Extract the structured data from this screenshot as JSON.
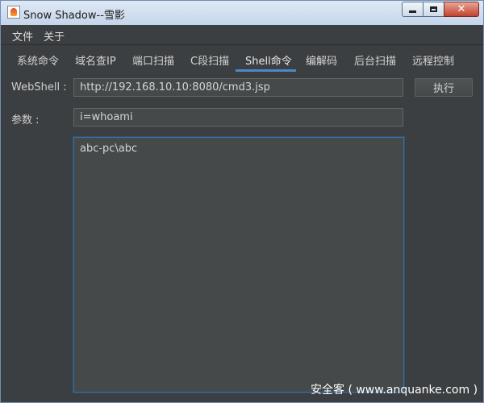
{
  "window": {
    "title": "Snow Shadow--雪影"
  },
  "menubar": {
    "items": [
      "文件",
      "关于"
    ]
  },
  "tabs": [
    {
      "label": "系统命令",
      "active": false
    },
    {
      "label": "域名查IP",
      "active": false
    },
    {
      "label": "端口扫描",
      "active": false
    },
    {
      "label": "C段扫描",
      "active": false
    },
    {
      "label": "Shell命令",
      "active": true
    },
    {
      "label": "编解码",
      "active": false
    },
    {
      "label": "后台扫描",
      "active": false
    },
    {
      "label": "远程控制",
      "active": false
    }
  ],
  "form": {
    "webshell_label": "WebShell :",
    "webshell_value": "http://192.168.10.10:8080/cmd3.jsp",
    "execute_label": "执行",
    "params_label": "参数 :",
    "params_value": "i=whoami",
    "output_text": "abc-pc\\abc"
  },
  "watermark": "安全客 ( www.anquanke.com )",
  "colors": {
    "background": "#3c3f41",
    "input_background": "#45494a",
    "accent": "#4a88c7",
    "titlebar": "#c4d5ea"
  }
}
